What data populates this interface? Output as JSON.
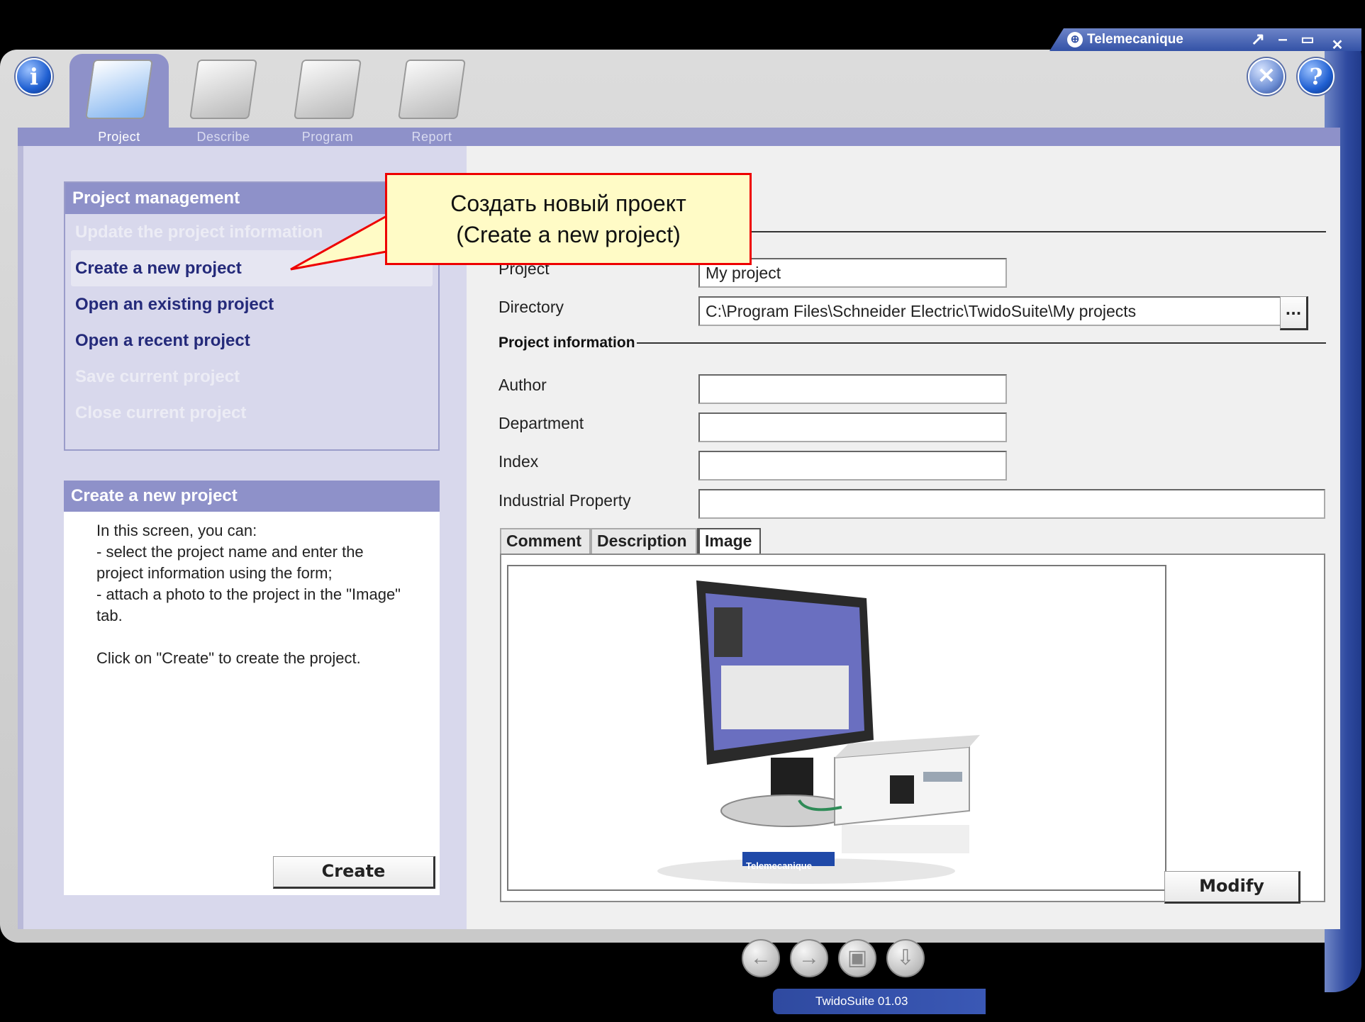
{
  "window": {
    "brand": "Telemecanique",
    "controls": {
      "restore": "↗",
      "minimize": "–",
      "maximize": "▭",
      "close": "✕"
    }
  },
  "toolbar": {
    "info_label": "i",
    "help_label": "?",
    "tabs": [
      {
        "label": "Project",
        "active": true
      },
      {
        "label": "Describe",
        "active": false
      },
      {
        "label": "Program",
        "active": false
      },
      {
        "label": "Report",
        "active": false
      }
    ]
  },
  "project_management": {
    "title": "Project management",
    "items": [
      {
        "label": "Update the project information",
        "state": "disabled"
      },
      {
        "label": "Create a new project",
        "state": "selected"
      },
      {
        "label": "Open an existing project",
        "state": "enabled"
      },
      {
        "label": "Open a recent project",
        "state": "enabled"
      },
      {
        "label": "Save current project",
        "state": "disabled"
      },
      {
        "label": "Close current project",
        "state": "disabled"
      }
    ]
  },
  "create_panel": {
    "title": "Create a new project",
    "text": "In this screen, you can:\n - select the project name and enter the project information using the form;\n - attach a photo to the project in the \"Image\" tab.\n\nClick on \"Create\" to create the project.",
    "create_button": "Create"
  },
  "form": {
    "project_label": "Project",
    "project_value": "My project",
    "directory_label": "Directory",
    "directory_value": "C:\\Program Files\\Schneider Electric\\TwidoSuite\\My projects",
    "browse_label": "...",
    "project_info_title": "Project information",
    "author_label": "Author",
    "author_value": "",
    "department_label": "Department",
    "department_value": "",
    "index_label": "Index",
    "index_value": "",
    "industrial_property_label": "Industrial Property",
    "industrial_property_value": "",
    "tabs": [
      "Comment",
      "Description",
      "Image"
    ],
    "active_tab": "Image",
    "modify_button": "Modify",
    "image_logo_text": "Telemecanique"
  },
  "callout": {
    "line1": "Создать новый проект",
    "line2": "(Create a new project)"
  },
  "footer": {
    "nav_buttons": [
      "back",
      "forward",
      "save",
      "export"
    ],
    "version": "TwidoSuite 01.03"
  },
  "colors": {
    "accent": "#8e91c9",
    "brand_blue": "#3352a6",
    "callout_border": "#e00000",
    "callout_fill": "#fffbc6"
  }
}
